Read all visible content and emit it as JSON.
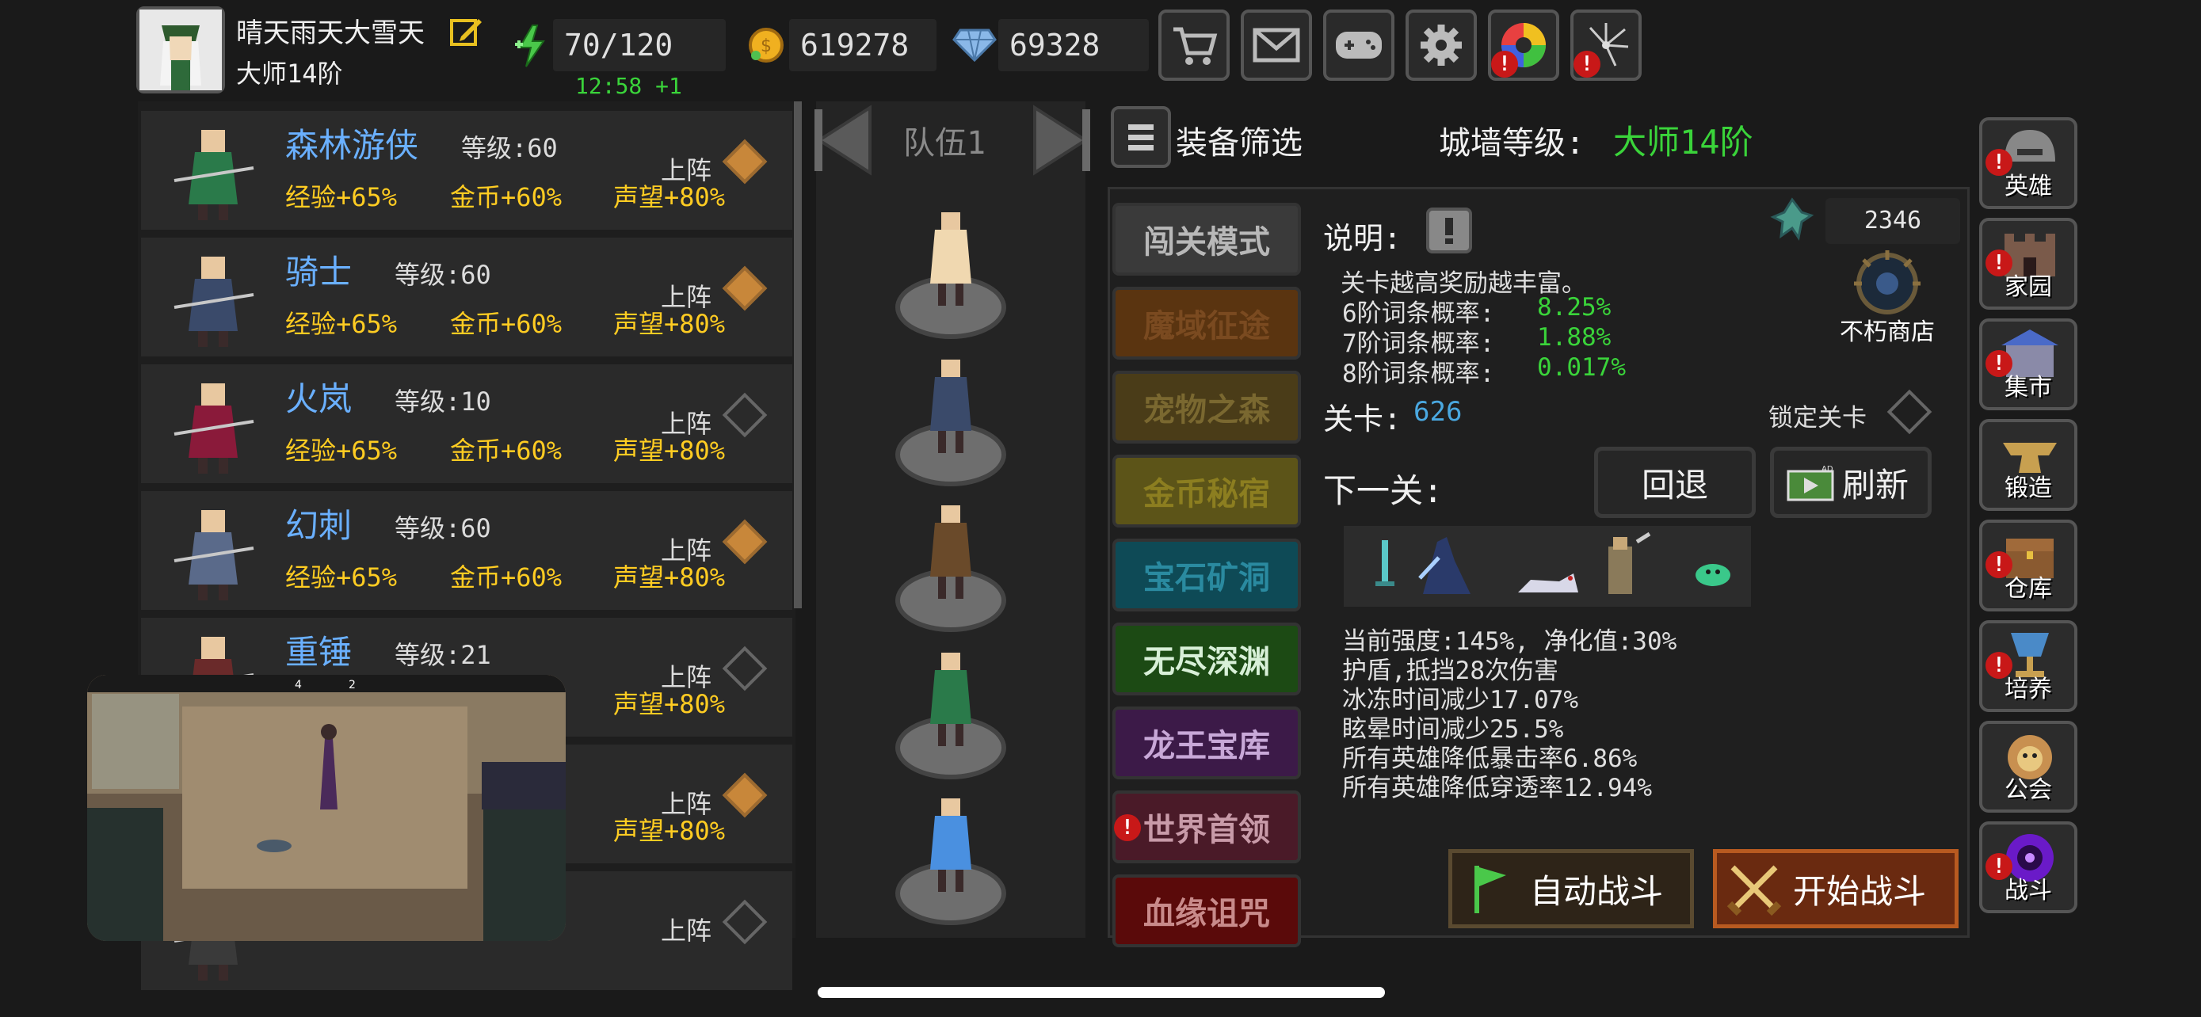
{
  "player": {
    "name": "晴天雨天大雪天",
    "rank": "大师14阶"
  },
  "resources": {
    "stamina": "70/120",
    "stamina_timer": "12:58 +1",
    "gold": "619278",
    "gems": "69328"
  },
  "toolbar": {
    "icons": [
      "cart-icon",
      "mail-icon",
      "gamepad-icon",
      "gear-icon",
      "color-wheel-icon",
      "firework-icon"
    ]
  },
  "heroes": [
    {
      "name": "森林游侠",
      "level": "等级:60",
      "buff_exp": "经验+65%",
      "buff_gold": "金币+60%",
      "buff_fame": "声望+80%",
      "deploy": "上阵",
      "active": true
    },
    {
      "name": "骑士",
      "level": "等级:60",
      "buff_exp": "经验+65%",
      "buff_gold": "金币+60%",
      "buff_fame": "声望+80%",
      "deploy": "上阵",
      "active": true
    },
    {
      "name": "火岚",
      "level": "等级:10",
      "buff_exp": "经验+65%",
      "buff_gold": "金币+60%",
      "buff_fame": "声望+80%",
      "deploy": "上阵",
      "active": false
    },
    {
      "name": "幻刺",
      "level": "等级:60",
      "buff_exp": "经验+65%",
      "buff_gold": "金币+60%",
      "buff_fame": "声望+80%",
      "deploy": "上阵",
      "active": true
    },
    {
      "name": "重锤",
      "level": "等级:21",
      "buff_exp": "",
      "buff_gold": "",
      "buff_fame": "声望+80%",
      "deploy": "上阵",
      "active": false
    },
    {
      "name": "",
      "level": "",
      "buff_exp": "",
      "buff_gold": "",
      "buff_fame": "声望+80%",
      "deploy": "上阵",
      "active": true
    },
    {
      "name": "",
      "level": "",
      "buff_exp": "",
      "buff_gold": "",
      "buff_fame": "",
      "deploy": "上阵",
      "active": false
    }
  ],
  "team": {
    "title": "队伍1"
  },
  "header": {
    "filter_label": "装备筛选",
    "wall_label": "城墙等级:",
    "wall_value": "大师14阶"
  },
  "modes": [
    {
      "label": "闯关模式",
      "color": "#3a3a3a",
      "text": "#b8b8b8"
    },
    {
      "label": "魔域征途",
      "color": "#5a3410",
      "text": "#7a4a20"
    },
    {
      "label": "宠物之森",
      "color": "#4a3c18",
      "text": "#7a6830"
    },
    {
      "label": "金币秘宿",
      "color": "#5c5418",
      "text": "#8c7e20"
    },
    {
      "label": "宝石矿洞",
      "color": "#0e4a56",
      "text": "#2a8aa0"
    },
    {
      "label": "无尽深渊",
      "color": "#1c4a14",
      "text": "#d8f0d8"
    },
    {
      "label": "龙王宝库",
      "color": "#3c1a48",
      "text": "#c8a8d8"
    },
    {
      "label": "世界首领",
      "color": "#4a1a28",
      "text": "#c89aa8"
    },
    {
      "label": "血缘诅咒",
      "color": "#5a0a0a",
      "text": "#c88a8a"
    }
  ],
  "info": {
    "desc_label": "说明:",
    "desc_text": "关卡越高奖励越丰富。",
    "rates": [
      {
        "label": "6阶词条概率:",
        "value": "8.25%"
      },
      {
        "label": "7阶词条概率:",
        "value": "1.88%"
      },
      {
        "label": "8阶词条概率:",
        "value": "0.017%"
      }
    ],
    "crystal_count": "2346",
    "shop_label": "不朽商店",
    "stage_label": "关卡:",
    "stage_value": "626",
    "lock_label": "锁定关卡",
    "next_label": "下一关:",
    "back_button": "回退",
    "refresh_button": "刷新",
    "stats": [
      "当前强度:145%, 净化值:30%",
      "护盾,抵挡28次伤害",
      "冰冻时间减少17.07%",
      "眩晕时间减少25.5%",
      "所有英雄降低暴击率6.86%",
      "所有英雄降低穿透率12.94%"
    ],
    "auto_battle": "自动战斗",
    "start_battle": "开始战斗"
  },
  "nav": [
    {
      "label": "英雄",
      "icon": "helmet-icon",
      "alert": true
    },
    {
      "label": "家园",
      "icon": "castle-icon",
      "alert": true
    },
    {
      "label": "集市",
      "icon": "market-icon",
      "alert": true
    },
    {
      "label": "锻造",
      "icon": "anvil-icon",
      "alert": false
    },
    {
      "label": "仓库",
      "icon": "chest-icon",
      "alert": true
    },
    {
      "label": "培养",
      "icon": "chalice-icon",
      "alert": true
    },
    {
      "label": "公会",
      "icon": "lion-icon",
      "alert": false
    },
    {
      "label": "战斗",
      "icon": "portal-icon",
      "alert": true
    }
  ],
  "pip": {
    "score_left": "4",
    "score_right": "2"
  }
}
